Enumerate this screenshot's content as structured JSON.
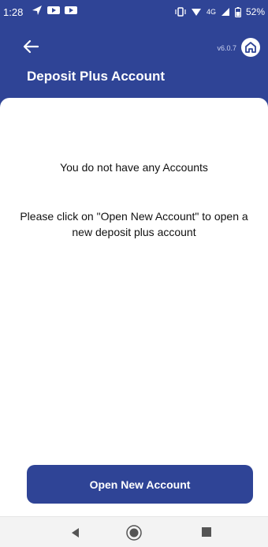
{
  "status_bar": {
    "time": "1:28",
    "network": "4G",
    "battery": "52%"
  },
  "header": {
    "version": "v6.0.7",
    "title": "Deposit Plus Account"
  },
  "content": {
    "empty_title": "You do not have any Accounts",
    "instruction": "Please click on \"Open New Account\" to open a new deposit plus account"
  },
  "actions": {
    "open_new_account_label": "Open New Account"
  },
  "colors": {
    "primary": "#2f4496",
    "background": "#ffffff",
    "nav_bar": "#f3f3f3"
  },
  "icons": {
    "back": "arrow-left-icon",
    "home": "home-icon",
    "nav_back": "triangle-back-icon",
    "nav_home": "circle-home-icon",
    "nav_recent": "square-recent-icon"
  }
}
